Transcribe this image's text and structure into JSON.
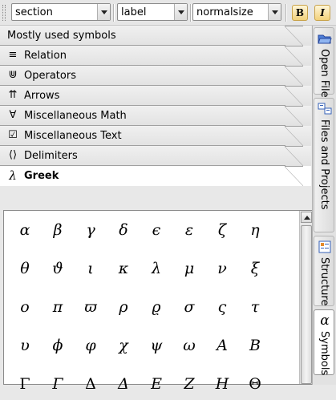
{
  "toolbar": {
    "section_combo": "section",
    "label_combo": "label",
    "size_combo": "normalsize",
    "bold_label": "B",
    "italic_label": "I"
  },
  "groups": [
    {
      "label": "Mostly used symbols",
      "icon": "none"
    },
    {
      "label": "Relation",
      "icon": "≡"
    },
    {
      "label": "Operators",
      "icon": "⋓"
    },
    {
      "label": "Arrows",
      "icon": "⇈"
    },
    {
      "label": "Miscellaneous Math",
      "icon": "∀"
    },
    {
      "label": "Miscellaneous Text",
      "icon": "☑"
    },
    {
      "label": "Delimiters",
      "icon": "⟨⟩"
    },
    {
      "label": "Greek",
      "icon": "λ",
      "active": true
    }
  ],
  "symbols": [
    [
      "α",
      "β",
      "γ",
      "δ",
      "ϵ",
      "ε",
      "ζ",
      "η"
    ],
    [
      "θ",
      "ϑ",
      "ι",
      "κ",
      "λ",
      "μ",
      "ν",
      "ξ"
    ],
    [
      "o",
      "π",
      "ϖ",
      "ρ",
      "ϱ",
      "σ",
      "ς",
      "τ"
    ],
    [
      "υ",
      "ϕ",
      "φ",
      "χ",
      "ψ",
      "ω",
      "A",
      "B"
    ],
    [
      "Γ",
      "Γ",
      "Δ",
      "Δ",
      "E",
      "Z",
      "H",
      "Θ"
    ]
  ],
  "side_tabs": [
    {
      "label": "Open File",
      "icon": "folder-open-icon"
    },
    {
      "label": "Files and Projects",
      "icon": "files-icon"
    },
    {
      "label": "Structure",
      "icon": "structure-icon"
    },
    {
      "label": "Symbols",
      "icon": "alpha-icon",
      "glyph": "α",
      "active": true
    }
  ]
}
